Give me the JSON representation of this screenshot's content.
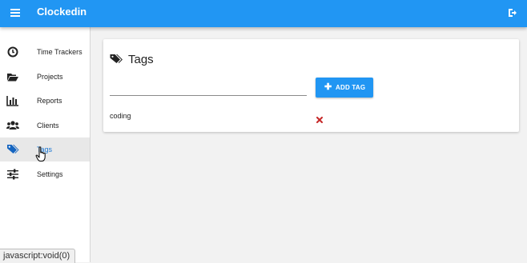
{
  "header": {
    "title": "Clockedin",
    "menu_icon": "hamburger-menu-icon",
    "logout_icon": "sign-out-icon",
    "color": "#2196f3"
  },
  "sidebar": {
    "items": [
      {
        "label": "Time Trackers",
        "icon": "clock-icon"
      },
      {
        "label": "Projects",
        "icon": "folder-open-icon"
      },
      {
        "label": "Reports",
        "icon": "bar-chart-icon"
      },
      {
        "label": "Clients",
        "icon": "users-icon"
      },
      {
        "label": "Tags",
        "icon": "tags-icon",
        "active": true
      },
      {
        "label": "Settings",
        "icon": "sliders-icon"
      }
    ]
  },
  "main": {
    "card": {
      "heading": "Tags",
      "input_value": "",
      "add_button_label": "ADD TAG",
      "tags": [
        {
          "name": "coding"
        }
      ]
    }
  },
  "status_bar": {
    "text": "javascript:void(0)"
  },
  "colors": {
    "accent": "#2196f3",
    "delete": "#c62828",
    "active_item_bg": "#e8e8e8"
  }
}
